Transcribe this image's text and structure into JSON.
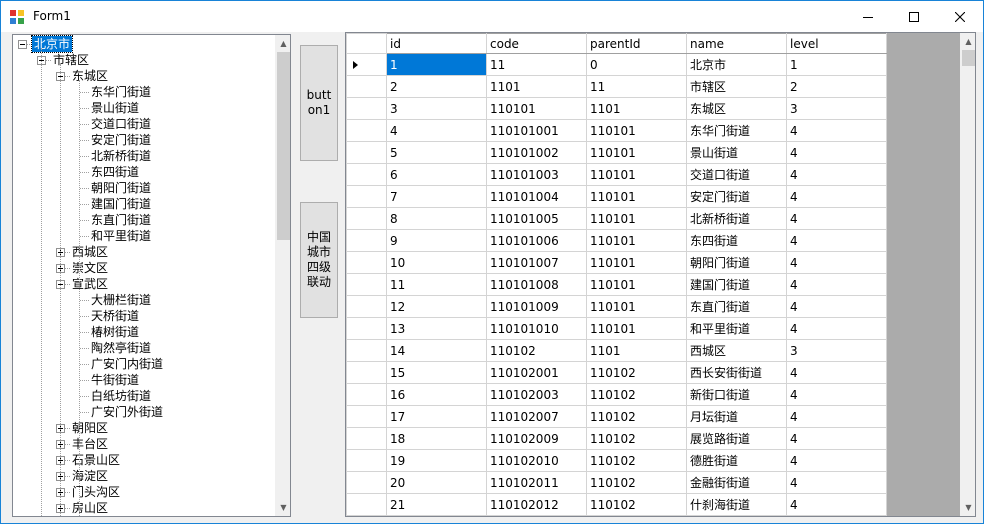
{
  "window": {
    "title": "Form1",
    "accent": "#1883d7"
  },
  "tree": {
    "nodes": [
      {
        "label": "北京市",
        "level": 0,
        "expander": "minus",
        "selected": true
      },
      {
        "label": "市辖区",
        "level": 1,
        "expander": "minus"
      },
      {
        "label": "东城区",
        "level": 2,
        "expander": "minus"
      },
      {
        "label": "东华门街道",
        "level": 3,
        "expander": "none"
      },
      {
        "label": "景山街道",
        "level": 3,
        "expander": "none"
      },
      {
        "label": "交道口街道",
        "level": 3,
        "expander": "none"
      },
      {
        "label": "安定门街道",
        "level": 3,
        "expander": "none"
      },
      {
        "label": "北新桥街道",
        "level": 3,
        "expander": "none"
      },
      {
        "label": "东四街道",
        "level": 3,
        "expander": "none"
      },
      {
        "label": "朝阳门街道",
        "level": 3,
        "expander": "none"
      },
      {
        "label": "建国门街道",
        "level": 3,
        "expander": "none"
      },
      {
        "label": "东直门街道",
        "level": 3,
        "expander": "none"
      },
      {
        "label": "和平里街道",
        "level": 3,
        "expander": "none"
      },
      {
        "label": "西城区",
        "level": 2,
        "expander": "plus"
      },
      {
        "label": "崇文区",
        "level": 2,
        "expander": "plus"
      },
      {
        "label": "宣武区",
        "level": 2,
        "expander": "minus"
      },
      {
        "label": "大栅栏街道",
        "level": 3,
        "expander": "none"
      },
      {
        "label": "天桥街道",
        "level": 3,
        "expander": "none"
      },
      {
        "label": "椿树街道",
        "level": 3,
        "expander": "none"
      },
      {
        "label": "陶然亭街道",
        "level": 3,
        "expander": "none"
      },
      {
        "label": "广安门内街道",
        "level": 3,
        "expander": "none"
      },
      {
        "label": "牛街街道",
        "level": 3,
        "expander": "none"
      },
      {
        "label": "白纸坊街道",
        "level": 3,
        "expander": "none"
      },
      {
        "label": "广安门外街道",
        "level": 3,
        "expander": "none"
      },
      {
        "label": "朝阳区",
        "level": 2,
        "expander": "plus"
      },
      {
        "label": "丰台区",
        "level": 2,
        "expander": "plus"
      },
      {
        "label": "石景山区",
        "level": 2,
        "expander": "plus"
      },
      {
        "label": "海淀区",
        "level": 2,
        "expander": "plus"
      },
      {
        "label": "门头沟区",
        "level": 2,
        "expander": "plus"
      },
      {
        "label": "房山区",
        "level": 2,
        "expander": "plus"
      }
    ]
  },
  "buttons": {
    "button1_label": "button1",
    "button2_label": "中国城市四级联动"
  },
  "grid": {
    "columns": [
      "id",
      "code",
      "parentId",
      "name",
      "level"
    ],
    "current_row": 0,
    "rows": [
      [
        "1",
        "11",
        "0",
        "北京市",
        "1"
      ],
      [
        "2",
        "1101",
        "11",
        "市辖区",
        "2"
      ],
      [
        "3",
        "110101",
        "1101",
        "东城区",
        "3"
      ],
      [
        "4",
        "110101001",
        "110101",
        "东华门街道",
        "4"
      ],
      [
        "5",
        "110101002",
        "110101",
        "景山街道",
        "4"
      ],
      [
        "6",
        "110101003",
        "110101",
        "交道口街道",
        "4"
      ],
      [
        "7",
        "110101004",
        "110101",
        "安定门街道",
        "4"
      ],
      [
        "8",
        "110101005",
        "110101",
        "北新桥街道",
        "4"
      ],
      [
        "9",
        "110101006",
        "110101",
        "东四街道",
        "4"
      ],
      [
        "10",
        "110101007",
        "110101",
        "朝阳门街道",
        "4"
      ],
      [
        "11",
        "110101008",
        "110101",
        "建国门街道",
        "4"
      ],
      [
        "12",
        "110101009",
        "110101",
        "东直门街道",
        "4"
      ],
      [
        "13",
        "110101010",
        "110101",
        "和平里街道",
        "4"
      ],
      [
        "14",
        "110102",
        "1101",
        "西城区",
        "3"
      ],
      [
        "15",
        "110102001",
        "110102",
        "西长安街街道",
        "4"
      ],
      [
        "16",
        "110102003",
        "110102",
        "新街口街道",
        "4"
      ],
      [
        "17",
        "110102007",
        "110102",
        "月坛街道",
        "4"
      ],
      [
        "18",
        "110102009",
        "110102",
        "展览路街道",
        "4"
      ],
      [
        "19",
        "110102010",
        "110102",
        "德胜街道",
        "4"
      ],
      [
        "20",
        "110102011",
        "110102",
        "金融街街道",
        "4"
      ],
      [
        "21",
        "110102012",
        "110102",
        "什刹海街道",
        "4"
      ]
    ]
  }
}
